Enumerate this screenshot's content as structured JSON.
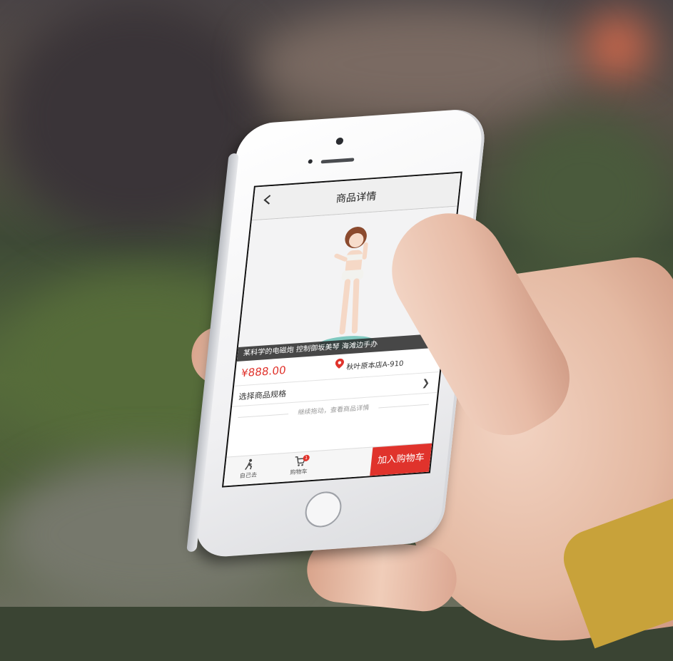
{
  "navbar": {
    "title": "商品详情",
    "back_icon": "chevron-left-icon"
  },
  "product": {
    "caption": "某科学的电磁炮 控制御坂美琴 海滩边手办",
    "price": "¥888.00",
    "location_icon": "map-pin-icon",
    "shop": "秋叶原本店A-910"
  },
  "spec": {
    "label": "选择商品规格",
    "chevron_icon": "chevron-right-icon"
  },
  "hint": "继续拖动，查看商品详情",
  "tabbar": {
    "tab1_label": "自己去",
    "tab1_icon": "walking-person-icon",
    "tab2_label": "购物车",
    "tab2_icon": "cart-icon",
    "cart_badge": "1",
    "add_to_cart_label": "加入购物车"
  },
  "colors": {
    "accent": "#e0332c",
    "navbar_bg": "#efefef"
  }
}
